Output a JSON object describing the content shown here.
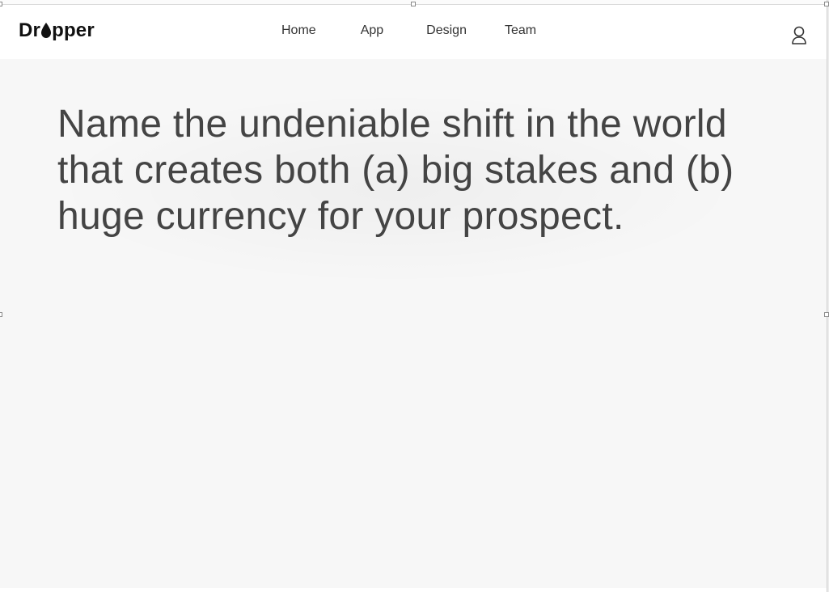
{
  "brand": {
    "logo_prefix": "Dr",
    "logo_suffix": "pper",
    "logo_full": "Dropper"
  },
  "nav": {
    "items": [
      {
        "label": "Home"
      },
      {
        "label": "App"
      },
      {
        "label": "Design"
      },
      {
        "label": "Team"
      }
    ]
  },
  "user": {
    "icon": "user-icon"
  },
  "hero": {
    "headline": "Name the undeniable shift in the world that creates both (a) big stakes and (b) huge currency for your prospect."
  },
  "colors": {
    "background": "#f7f7f7",
    "navbar": "#ffffff",
    "text": "#444444",
    "logo": "#111111"
  }
}
